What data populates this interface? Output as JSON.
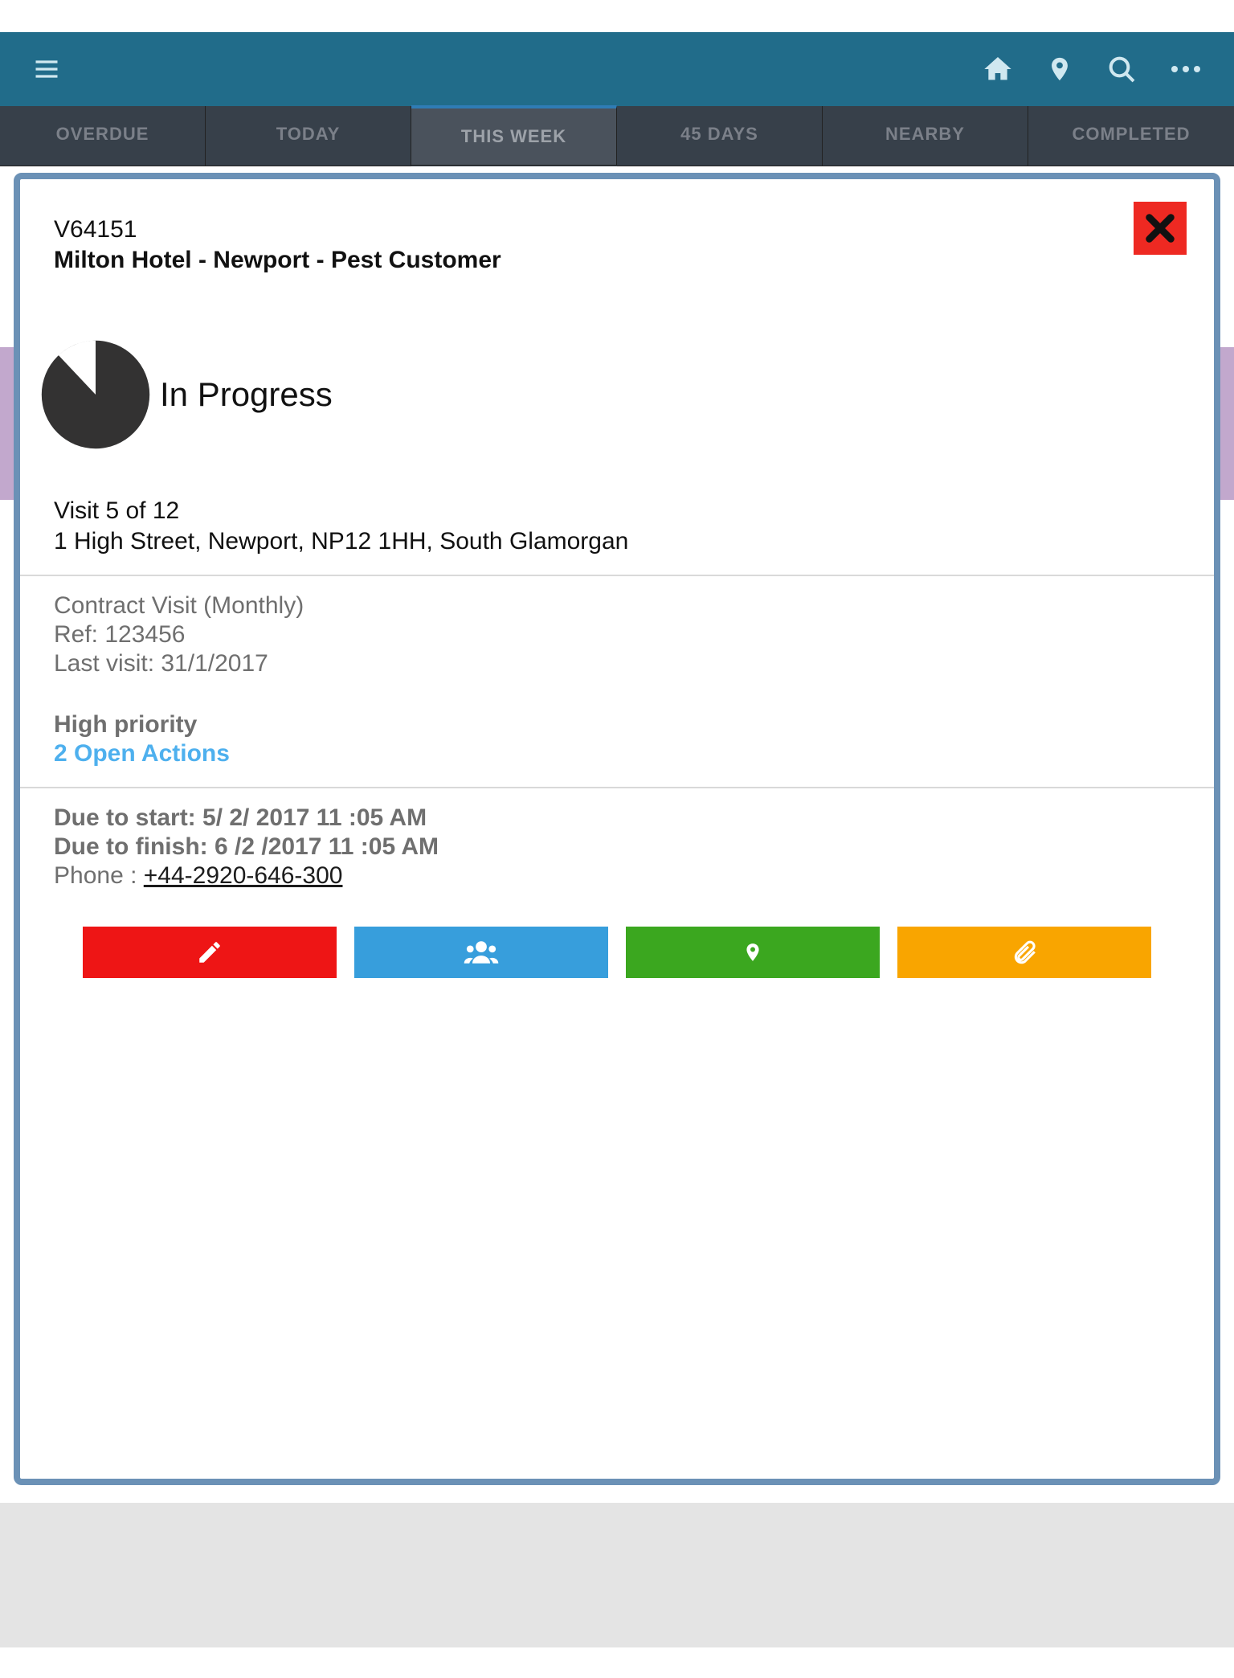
{
  "tabs": [
    {
      "label": "OVERDUE"
    },
    {
      "label": "TODAY"
    },
    {
      "label": "THIS WEEK"
    },
    {
      "label": "45 DAYS"
    },
    {
      "label": "NEARBY"
    },
    {
      "label": "COMPLETED"
    }
  ],
  "visit": {
    "id": "V64151",
    "title": "Milton Hotel - Newport - Pest Customer",
    "status": "In Progress",
    "visit_count": "Visit 5 of 12",
    "address": "1 High Street, Newport, NP12 1HH, South Glamorgan",
    "contract": "Contract Visit (Monthly)",
    "ref": "Ref: 123456",
    "last_visit": "Last visit: 31/1/2017",
    "priority": "High priority",
    "open_actions": "2 Open Actions",
    "due_start": "Due to start: 5/ 2/ 2017 11 :05 AM",
    "due_finish": "Due to finish: 6 /2 /2017 11 :05 AM",
    "phone_label": "Phone : ",
    "phone": "+44-2920-646-300"
  }
}
